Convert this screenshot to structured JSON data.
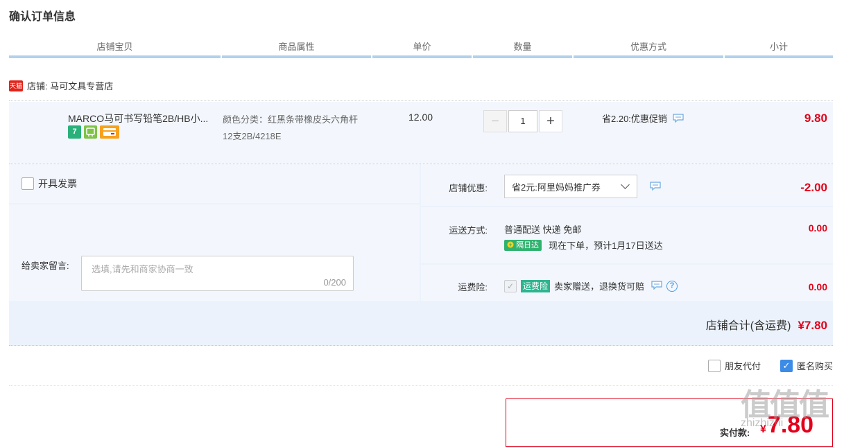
{
  "page_title": "确认订单信息",
  "columns": [
    "店铺宝贝",
    "商品属性",
    "单价",
    "数量",
    "优惠方式",
    "小计"
  ],
  "shop": {
    "badge": "天猫",
    "label": "店铺: 马可文具专营店"
  },
  "item": {
    "name": "MARCO马可书写铅笔2B/HB小...",
    "service_icons": [
      "seven-day-return-icon",
      "guarantee-icon",
      "credit-card-icon"
    ],
    "service_icon_7": "7",
    "attr_line1": "颜色分类：红黑条带橡皮头六角杆",
    "attr_line2": "12支2B/4218E",
    "price": "12.00",
    "quantity": "1",
    "minus": "−",
    "plus": "+",
    "promo": "省2.20:优惠促销",
    "subtotal": "9.80"
  },
  "invoice": {
    "label": "开具发票"
  },
  "message": {
    "label": "给卖家留言:",
    "placeholder": "选填,请先和商家协商一致",
    "count": "0/200"
  },
  "shop_discount": {
    "label": "店铺优惠:",
    "selected": "省2元:阿里妈妈推广券",
    "amount": "-2.00"
  },
  "shipping": {
    "label": "运送方式:",
    "method": "普通配送 快递 免邮",
    "tag": "隔日达",
    "eta": "现在下单，预计1月17日送达",
    "amount": "0.00"
  },
  "insurance": {
    "label": "运费险:",
    "tag": "运费险",
    "desc": "卖家赠送，退换货可赔",
    "help": "?",
    "amount": "0.00"
  },
  "shop_total": {
    "label": "店铺合计(含运费)",
    "amount": "¥7.80"
  },
  "extra": {
    "friend_pay": "朋友代付",
    "anonymous": "匿名购买",
    "anonymous_checked": true
  },
  "pay": {
    "label": "实付款:",
    "currency": "¥",
    "amount": "7.80"
  },
  "watermark": {
    "text": "值值值",
    "sub": "zhizhizhi"
  },
  "colors": {
    "accent_red": "#e2001a",
    "header_line": "#b2d1ec",
    "row_bg": "#f3f7fd",
    "checkbox_blue": "#3c8be6"
  }
}
